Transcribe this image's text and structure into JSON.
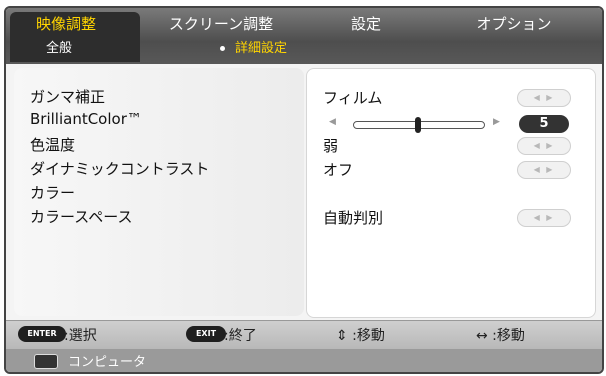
{
  "tabs": [
    {
      "label": "映像調整",
      "active": true
    },
    {
      "label": "スクリーン調整",
      "active": false
    },
    {
      "label": "設定",
      "active": false
    },
    {
      "label": "オプション",
      "active": false
    }
  ],
  "subtabs": [
    {
      "label": "全般",
      "selected": false
    },
    {
      "label": "詳細設定",
      "selected": true
    }
  ],
  "settings": [
    {
      "label": "ガンマ補正",
      "value": "フィルム",
      "control": "arrows"
    },
    {
      "label": "BrilliantColor™",
      "value": "5",
      "control": "slider",
      "level": 0.5
    },
    {
      "label": "色温度",
      "value": "弱",
      "control": "arrows"
    },
    {
      "label": "ダイナミックコントラスト",
      "value": "オフ",
      "control": "arrows"
    },
    {
      "label": "カラー",
      "value": "",
      "control": "none"
    },
    {
      "label": "カラースペース",
      "value": "自動判別",
      "control": "arrows"
    }
  ],
  "footer": {
    "enter_key": "ENTER",
    "enter_hint": ":選択",
    "exit_key": "EXIT",
    "exit_hint": ":終了",
    "updown_hint": "⇕ :移動",
    "leftright_hint": "↔ :移動"
  },
  "source": {
    "icon": "computer-icon",
    "label": "コンピュータ"
  },
  "colors": {
    "active_tab_text": "#ffd400",
    "tab_bar_bg": "#5a5a5a",
    "value_badge_bg": "#333333"
  }
}
